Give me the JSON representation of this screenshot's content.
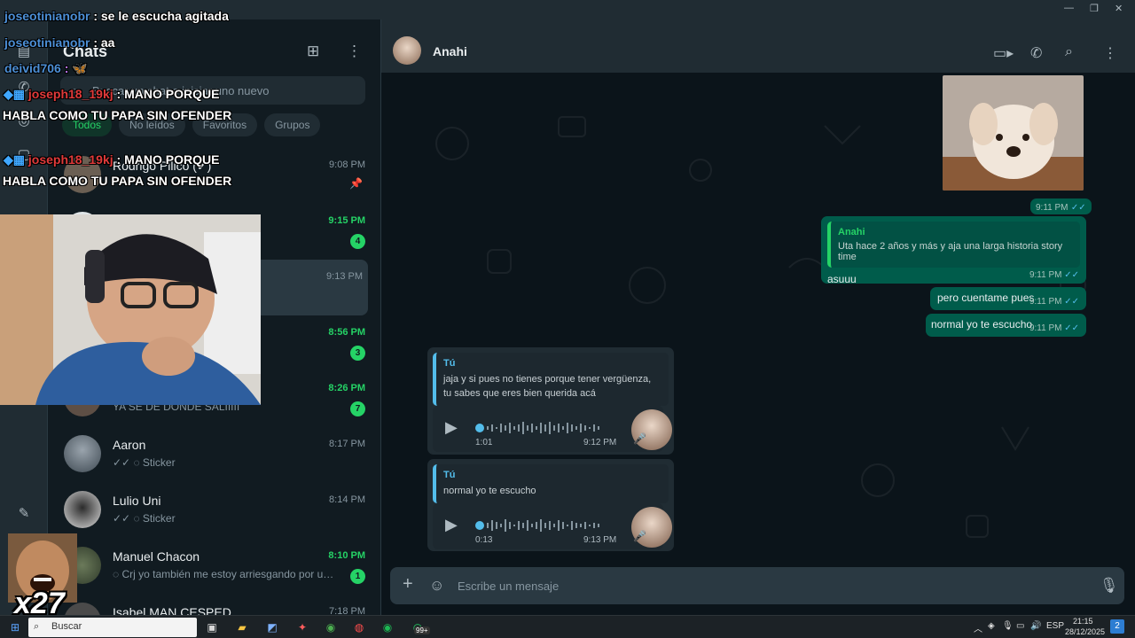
{
  "window": {
    "minimize": "—",
    "maximize": "❐",
    "close": "✕"
  },
  "sidebar": {
    "title": "Chats",
    "search_placeholder": "Buscar un chat o iniciar uno nuevo"
  },
  "filters": [
    "Todos",
    "No leídos",
    "Favoritos",
    "Grupos"
  ],
  "chats": [
    {
      "name": "Rodrigo Pilico (✔)",
      "time": "9:08 PM",
      "preview": "",
      "pinned": true,
      "unread": "",
      "highlight_time": false
    },
    {
      "name": "",
      "time": "9:15 PM",
      "preview": "",
      "pinned": false,
      "unread": "4",
      "highlight_time": true
    },
    {
      "name": "",
      "time": "9:13 PM",
      "preview": "",
      "pinned": false,
      "unread": "",
      "highlight_time": false,
      "selected": true
    },
    {
      "name": "",
      "time": "8:56 PM",
      "preview": "",
      "pinned": false,
      "unread": "3",
      "highlight_time": true
    },
    {
      "name": "",
      "time": "8:26 PM",
      "preview": "YA SE DE DONDE SALIIIII",
      "pinned": false,
      "unread": "7",
      "highlight_time": true
    },
    {
      "name": "Aaron",
      "time": "8:17 PM",
      "preview": "✓✓ ◌ Sticker",
      "pinned": false,
      "unread": "",
      "highlight_time": false
    },
    {
      "name": "Lulio Uni",
      "time": "8:14 PM",
      "preview": "✓✓ ◌ Sticker",
      "pinned": false,
      "unread": "",
      "highlight_time": false
    },
    {
      "name": "Manuel Chacon",
      "time": "8:10 PM",
      "preview": "◌ Crj yo también me estoy arriesgando por un...",
      "pinned": false,
      "unread": "1",
      "highlight_time": true
    },
    {
      "name": "Isabel MAN CESPED",
      "time": "7:18 PM",
      "preview": "",
      "pinned": false,
      "unread": "",
      "highlight_time": false
    }
  ],
  "conversation": {
    "contact_name": "Anahi",
    "messages_out": [
      {
        "time": "9:11 PM",
        "quote_author": "Anahi",
        "quote_text": "Uta hace 2 años y más y aja una larga historia story time",
        "text": "asuuu"
      },
      {
        "time": "9:11 PM",
        "text": "pero cuentame pues"
      },
      {
        "time": "9:11 PM",
        "text": "normal yo te escucho"
      }
    ],
    "sticker_time": "9:11 PM",
    "voice_messages": [
      {
        "quote_author": "Tú",
        "quote_text": "jaja y si pues no tienes porque tener vergüenza, tu sabes que eres bien querida acá",
        "duration": "1:01",
        "time": "9:12 PM"
      },
      {
        "quote_author": "Tú",
        "quote_text": "normal yo te escucho",
        "duration": "0:13",
        "time": "9:13 PM"
      }
    ],
    "composer_placeholder": "Escribe un mensaje"
  },
  "overlay": {
    "chat_lines": [
      {
        "user": "joseotinianobr",
        "text": " : se le escucha agitada"
      },
      {
        "user": "joseotinianobr",
        "text": " : aa"
      },
      {
        "user": "deivid706",
        "text": " : 🦋"
      },
      {
        "user": "joseph18_19kj",
        "text": " : MANO PORQUE"
      },
      {
        "user": "",
        "text": "HABLA COMO TU PAPA SIN OFENDER"
      },
      {
        "user": "joseph18_19kj",
        "text": " : MANO PORQUE"
      },
      {
        "user": "",
        "text": "HABLA COMO TU PAPA SIN OFENDER"
      }
    ],
    "multiplier": "x27"
  },
  "taskbar": {
    "search_label": "Buscar",
    "whatsapp_badge": "99+",
    "language": "ESP",
    "clock_time": "21:15",
    "clock_date": "28/12/2025",
    "notif_count": "2"
  },
  "colors": {
    "accent_green": "#25d366",
    "outgoing_bubble": "#005c4b",
    "incoming_bubble": "#202c33",
    "app_bg": "#111b21"
  }
}
